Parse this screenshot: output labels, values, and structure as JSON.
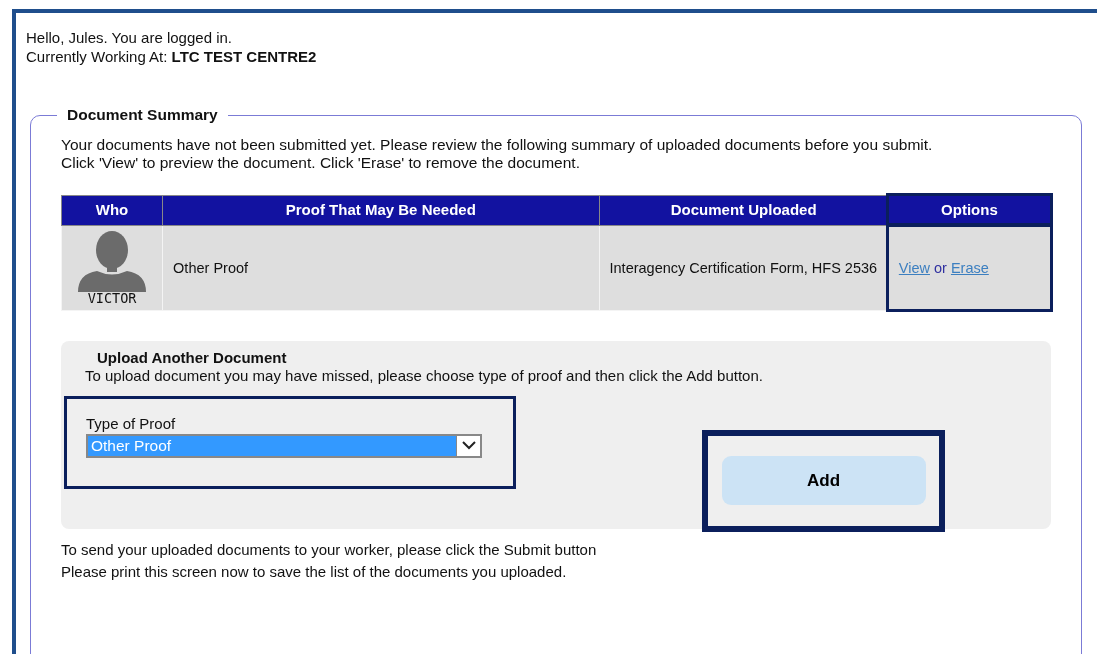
{
  "greeting": {
    "line": "Hello, Jules. You are logged in.",
    "working_at_label": "Currently Working At:",
    "working_at_value": "LTC TEST CENTRE2"
  },
  "summary": {
    "title": "Document Summary",
    "intro": [
      "Your documents have not been submitted yet. Please review the following summary of uploaded documents before you submit.",
      "Click 'View' to preview the document. Click 'Erase' to remove the document."
    ],
    "table": {
      "columns": [
        {
          "label": "Who",
          "highlighted": false
        },
        {
          "label": "Proof That May Be Needed",
          "highlighted": false
        },
        {
          "label": "Document Uploaded",
          "highlighted": false
        },
        {
          "label": "Options",
          "highlighted": true
        }
      ],
      "rows": [
        {
          "who": "VICTOR",
          "proof": "Other Proof",
          "document": "Interagency Certification Form, HFS 2536",
          "view_link": "View",
          "separator": "or",
          "erase_link": "Erase"
        }
      ]
    }
  },
  "upload": {
    "title": "Upload Another Document",
    "instructions": "To upload document you may have missed, please choose type of proof and then click the Add button.",
    "proof_type": {
      "label": "Type of Proof",
      "value": "Other Proof",
      "highlighted": true
    },
    "add_button": {
      "label": "Add",
      "highlighted": true
    }
  },
  "footer_notes": [
    "To send your uploaded documents to your worker, please click the Submit button",
    "Please print this screen now to save the list of the documents you uploaded."
  ]
}
